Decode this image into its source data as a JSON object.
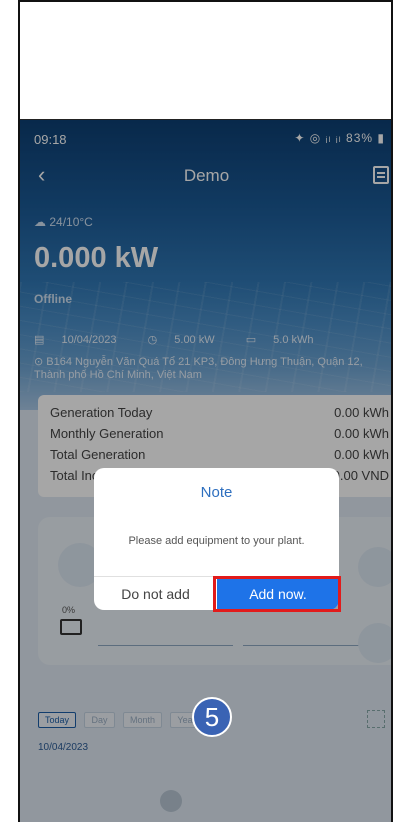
{
  "status": {
    "time": "09:18",
    "icons": "✦ ◎ ᵢₗ ᵢₗ",
    "battery": "83%"
  },
  "nav": {
    "title": "Demo"
  },
  "hero": {
    "weather": "24/10°C",
    "power": "0.000 kW",
    "state": "Offline",
    "date": "10/04/2023",
    "capacity": "5.00 kW",
    "storage": "5.0 kWh",
    "address": "B164 Nguyễn Văn Quá Tổ 21 KP3, Đông Hưng Thuận, Quận 12, Thành phố Hồ Chí Minh, Việt Nam"
  },
  "stats": [
    {
      "label": "Generation Today",
      "value": "0.00 kWh"
    },
    {
      "label": "Monthly Generation",
      "value": "0.00 kWh"
    },
    {
      "label": "Total Generation",
      "value": "0.00 kWh"
    },
    {
      "label": "Total Income",
      "value": "0.00 VND"
    }
  ],
  "flow": {
    "battery_pct": "0%"
  },
  "tabs": [
    "Today",
    "Day",
    "Month",
    "Year"
  ],
  "chart_date": "10/04/2023",
  "dialog": {
    "title": "Note",
    "message": "Please add equipment to your plant.",
    "cancel": "Do not add",
    "confirm": "Add now."
  },
  "step": "5"
}
